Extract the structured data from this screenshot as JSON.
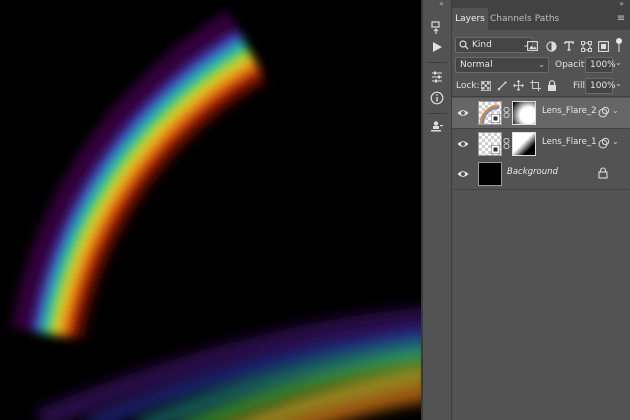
{
  "panel": {
    "tabs": [
      {
        "label": "Layers",
        "active": true
      },
      {
        "label": "Channels",
        "active": false
      },
      {
        "label": "Paths",
        "active": false
      }
    ],
    "collapse_glyph": "«",
    "collapse_glyph_right": "»",
    "filter": {
      "value": "Kind",
      "chevron": "⌄"
    },
    "blend_mode": {
      "value": "Normal",
      "chevron": "⌄"
    },
    "opacity": {
      "label": "Opacity:",
      "value": "100%",
      "chevron": "⌄"
    },
    "lock": {
      "label": "Lock:"
    },
    "fill": {
      "label": "Fill:",
      "value": "100%",
      "chevron": "⌄"
    },
    "menu_glyph": "≡"
  },
  "layers": [
    {
      "name": "Lens_Flare_2",
      "visible": true,
      "selected": true,
      "smart_object": true,
      "has_mask": true,
      "linked": true
    },
    {
      "name": "Lens_Flare_1",
      "visible": true,
      "selected": false,
      "smart_object": true,
      "has_mask": true,
      "linked": true
    },
    {
      "name": "Background",
      "visible": true,
      "selected": false,
      "locked": true,
      "fill_color": "#000000"
    }
  ],
  "colors": {
    "panel_bg": "#535353",
    "panel_dark": "#424242",
    "selected_layer": "#666666",
    "canvas_bg": "#000000"
  },
  "toolstrip": {
    "icons": [
      "history-icon",
      "play-action-icon",
      "adjustments-icon",
      "info-icon",
      "stamp-icon"
    ]
  }
}
